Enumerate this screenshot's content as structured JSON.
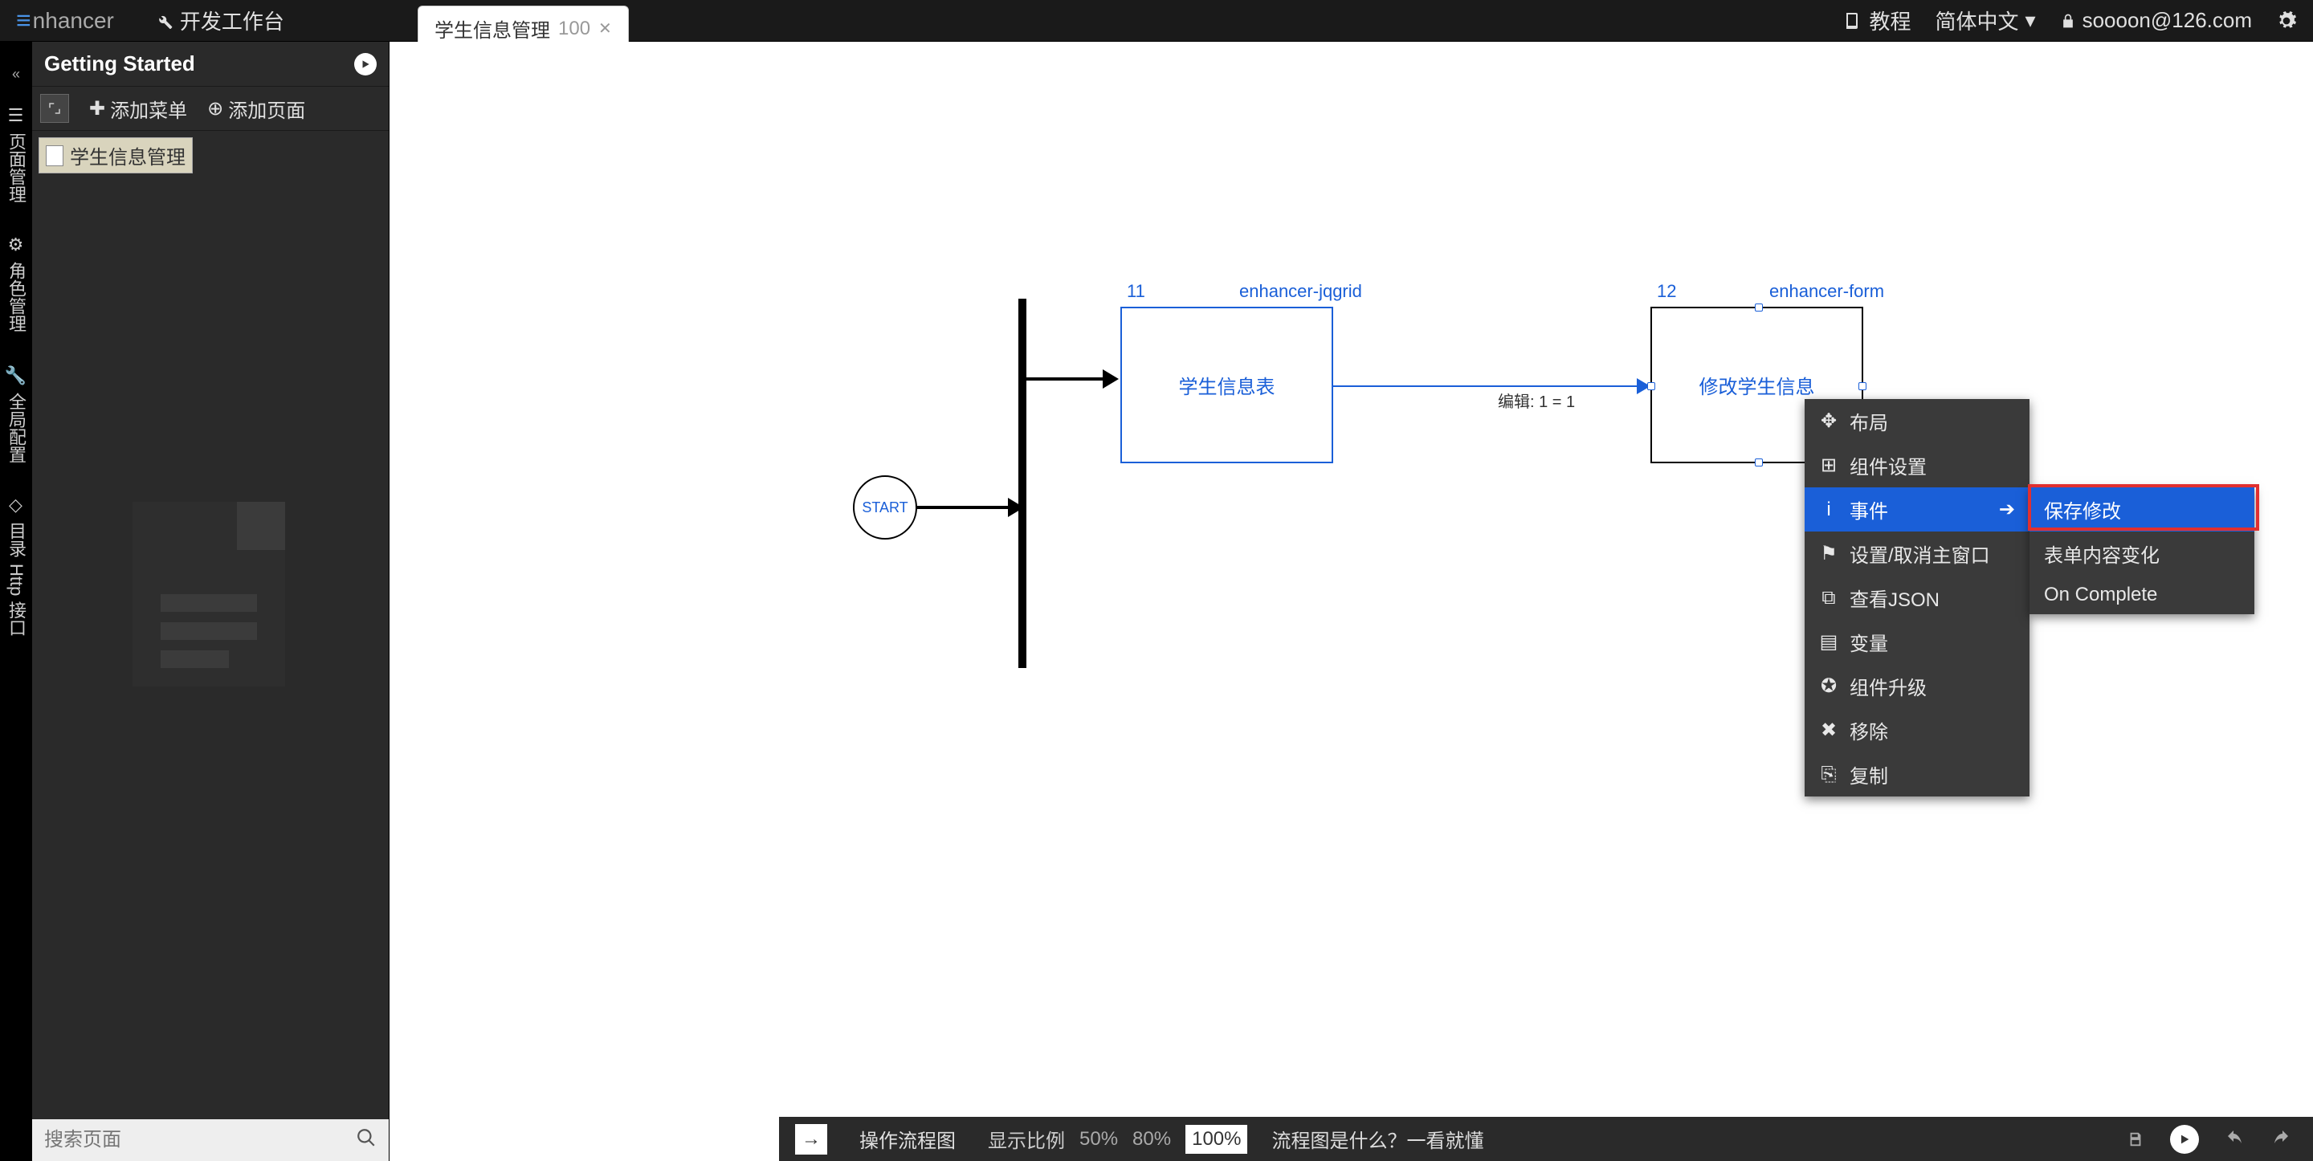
{
  "topbar": {
    "logo": "nhancer",
    "workspace": "开发工作台",
    "tutorial": "教程",
    "language": "简体中文",
    "user": "soooon@126.com"
  },
  "tab": {
    "title": "学生信息管理",
    "id": "100"
  },
  "leftRail": {
    "items": [
      "页面管理",
      "角色管理",
      "全局配置",
      "目录",
      "Http 接口"
    ]
  },
  "sidebar": {
    "header": "Getting Started",
    "addMenu": "添加菜单",
    "addPage": "添加页面",
    "treeItem": "学生信息管理",
    "searchPlaceholder": "搜索页面"
  },
  "flow": {
    "start": "START",
    "node1": {
      "id": "11",
      "type": "enhancer-jqgrid",
      "label": "学生信息表"
    },
    "node2": {
      "id": "12",
      "type": "enhancer-form",
      "label": "修改学生信息"
    },
    "connLabel": "编辑: 1 = 1"
  },
  "contextMenu": {
    "items": [
      {
        "icon": "move",
        "label": "布局"
      },
      {
        "icon": "grid",
        "label": "组件设置"
      },
      {
        "icon": "info",
        "label": "事件",
        "hasSubmenu": true,
        "highlight": true
      },
      {
        "icon": "flag",
        "label": "设置/取消主窗口"
      },
      {
        "icon": "code",
        "label": "查看JSON"
      },
      {
        "icon": "doc",
        "label": "变量"
      },
      {
        "icon": "upgrade",
        "label": "组件升级"
      },
      {
        "icon": "remove",
        "label": "移除"
      },
      {
        "icon": "copy",
        "label": "复制"
      }
    ],
    "submenu": [
      {
        "label": "保存修改",
        "highlight": true
      },
      {
        "label": "表单内容变化"
      },
      {
        "label": "On Complete"
      }
    ]
  },
  "bottombar": {
    "flowchart": "操作流程图",
    "zoomLabel": "显示比例",
    "zooms": [
      "50%",
      "80%",
      "100%"
    ],
    "activeZoom": "100%",
    "helpText": "流程图是什么？一看就懂"
  }
}
